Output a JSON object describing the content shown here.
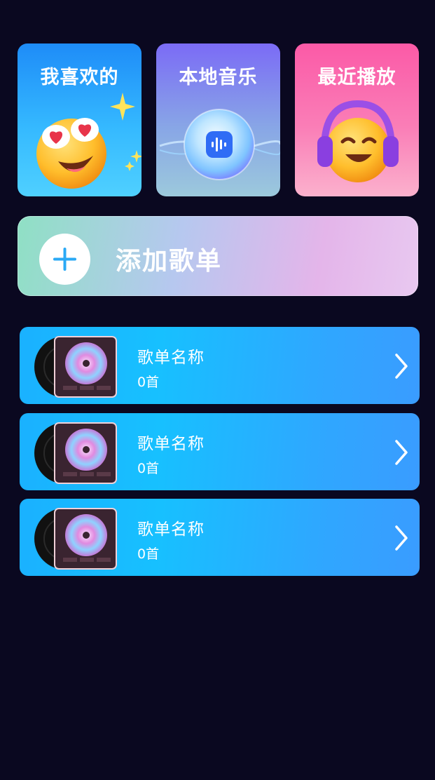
{
  "categories": [
    {
      "label": "我喜欢的",
      "icon": "heart-eyes-emoji-icon"
    },
    {
      "label": "本地音乐",
      "icon": "audio-bubble-icon"
    },
    {
      "label": "最近播放",
      "icon": "headphone-emoji-icon"
    }
  ],
  "add_playlist": {
    "label": "添加歌单",
    "icon": "plus-icon"
  },
  "playlists": [
    {
      "name": "歌单名称",
      "count": "0首",
      "icon": "chevron-right-icon"
    },
    {
      "name": "歌单名称",
      "count": "0首",
      "icon": "chevron-right-icon"
    },
    {
      "name": "歌单名称",
      "count": "0首",
      "icon": "chevron-right-icon"
    }
  ],
  "colors": {
    "background": "#0a0820",
    "favorite_card": "#35b9ff",
    "local_card": "#88a6e6",
    "recent_card": "#fa7eb7",
    "playlist_row": "#17c0ff",
    "plus_accent": "#2aa9f5"
  }
}
